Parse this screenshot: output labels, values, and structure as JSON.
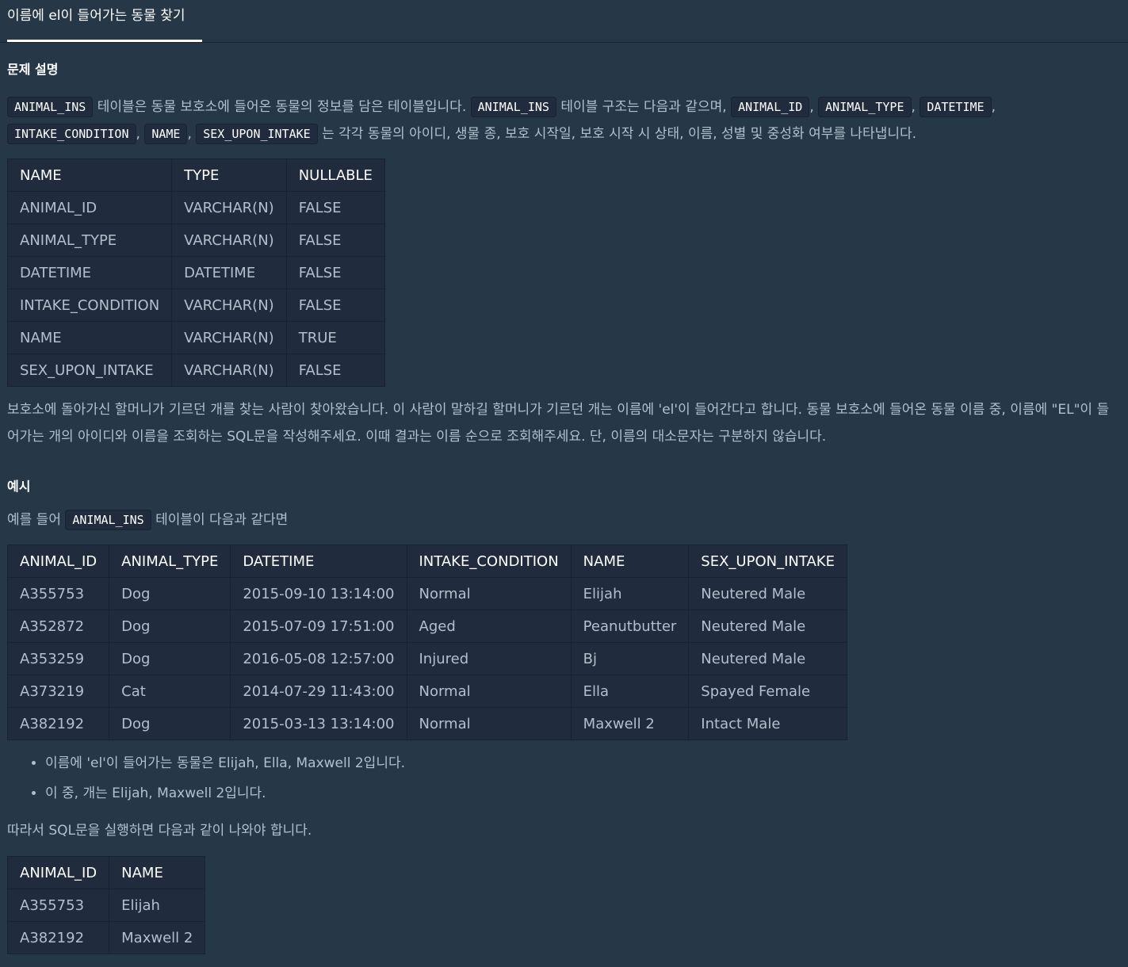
{
  "tab": {
    "title": "이름에 el이 들어가는 동물 찾기"
  },
  "description": {
    "heading": "문제 설명",
    "p1": {
      "code1": "ANIMAL_INS",
      "text1": " 테이블은 동물 보호소에 들어온 동물의 정보를 담은 테이블입니다. ",
      "code2": "ANIMAL_INS",
      "text2": " 테이블 구조는 다음과 같으며, ",
      "code3": "ANIMAL_ID",
      "sep1": ", ",
      "code4": "ANIMAL_TYPE",
      "sep2": ", ",
      "code5": "DATETIME",
      "sep3": ", ",
      "code6": "INTAKE_CONDITION",
      "sep4": ", ",
      "code7": "NAME",
      "sep5": ", ",
      "code8": "SEX_UPON_INTAKE",
      "text3": " 는 각각 동물의 아이디, 생물 종, 보호 시작일, 보호 시작 시 상태, 이름, 성별 및 중성화 여부를 나타냅니다."
    },
    "schema_table": {
      "headers": [
        "NAME",
        "TYPE",
        "NULLABLE"
      ],
      "rows": [
        [
          "ANIMAL_ID",
          "VARCHAR(N)",
          "FALSE"
        ],
        [
          "ANIMAL_TYPE",
          "VARCHAR(N)",
          "FALSE"
        ],
        [
          "DATETIME",
          "DATETIME",
          "FALSE"
        ],
        [
          "INTAKE_CONDITION",
          "VARCHAR(N)",
          "FALSE"
        ],
        [
          "NAME",
          "VARCHAR(N)",
          "TRUE"
        ],
        [
          "SEX_UPON_INTAKE",
          "VARCHAR(N)",
          "FALSE"
        ]
      ]
    },
    "p2": "보호소에 돌아가신 할머니가 기르던 개를 찾는 사람이 찾아왔습니다. 이 사람이 말하길 할머니가 기르던 개는 이름에 'el'이 들어간다고 합니다. 동물 보호소에 들어온 동물 이름 중, 이름에 \"EL\"이 들어가는 개의 아이디와 이름을 조회하는 SQL문을 작성해주세요. 이때 결과는 이름 순으로 조회해주세요. 단, 이름의 대소문자는 구분하지 않습니다."
  },
  "example": {
    "heading": "예시",
    "p3": {
      "text1": "예를 들어 ",
      "code1": "ANIMAL_INS",
      "text2": " 테이블이 다음과 같다면"
    },
    "table": {
      "headers": [
        "ANIMAL_ID",
        "ANIMAL_TYPE",
        "DATETIME",
        "INTAKE_CONDITION",
        "NAME",
        "SEX_UPON_INTAKE"
      ],
      "rows": [
        [
          "A355753",
          "Dog",
          "2015-09-10 13:14:00",
          "Normal",
          "Elijah",
          "Neutered Male"
        ],
        [
          "A352872",
          "Dog",
          "2015-07-09 17:51:00",
          "Aged",
          "Peanutbutter",
          "Neutered Male"
        ],
        [
          "A353259",
          "Dog",
          "2016-05-08 12:57:00",
          "Injured",
          "Bj",
          "Neutered Male"
        ],
        [
          "A373219",
          "Cat",
          "2014-07-29 11:43:00",
          "Normal",
          "Ella",
          "Spayed Female"
        ],
        [
          "A382192",
          "Dog",
          "2015-03-13 13:14:00",
          "Normal",
          "Maxwell 2",
          "Intact Male"
        ]
      ]
    },
    "bullets": [
      "이름에 'el'이 들어가는 동물은 Elijah, Ella, Maxwell 2입니다.",
      "이 중, 개는 Elijah, Maxwell 2입니다."
    ],
    "p4": "따라서 SQL문을 실행하면 다음과 같이 나와야 합니다.",
    "result": {
      "headers": [
        "ANIMAL_ID",
        "NAME"
      ],
      "rows": [
        [
          "A355753",
          "Elijah"
        ],
        [
          "A382192",
          "Maxwell 2"
        ]
      ]
    }
  }
}
